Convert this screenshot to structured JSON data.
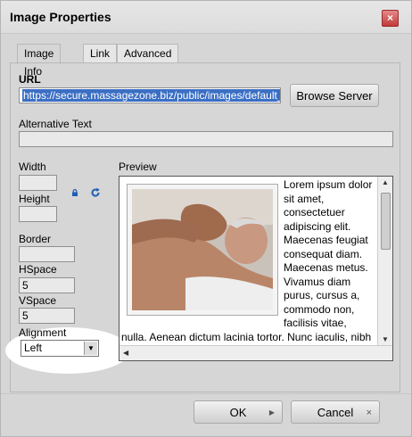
{
  "dialog": {
    "title": "Image Properties",
    "close_label": "×"
  },
  "tabs": [
    {
      "label": "Image Info"
    },
    {
      "label": "Link"
    },
    {
      "label": "Advanced"
    }
  ],
  "url": {
    "label": "URL",
    "value": "https://secure.massagezone.biz/public/images/default_",
    "browse_label": "Browse Server"
  },
  "alt": {
    "label": "Alternative Text",
    "value": ""
  },
  "dimensions": {
    "width_label": "Width",
    "width_value": "",
    "height_label": "Height",
    "height_value": ""
  },
  "spacing": {
    "border_label": "Border",
    "border_value": "",
    "hspace_label": "HSpace",
    "hspace_value": "5",
    "vspace_label": "VSpace",
    "vspace_value": "5"
  },
  "alignment": {
    "label": "Alignment",
    "selected": "Left"
  },
  "preview": {
    "label": "Preview",
    "text": "Lorem ipsum dolor sit amet, consectetuer adipiscing elit. Maecenas feugiat consequat diam. Maecenas metus. Vivamus diam purus, cursus a, commodo non, facilisis vitae, nulla. Aenean dictum lacinia tortor. Nunc iaculis, nibh non iaculis aliquam, orci felis euismod neque, sed ornare massa mauris sed velit."
  },
  "footer": {
    "ok_label": "OK",
    "cancel_label": "Cancel"
  },
  "colors": {
    "dialog_bg": "#d6d6d6",
    "selection": "#3b6fc4",
    "close_red": "#c23a3a",
    "icon_blue": "#1f5fb5"
  }
}
